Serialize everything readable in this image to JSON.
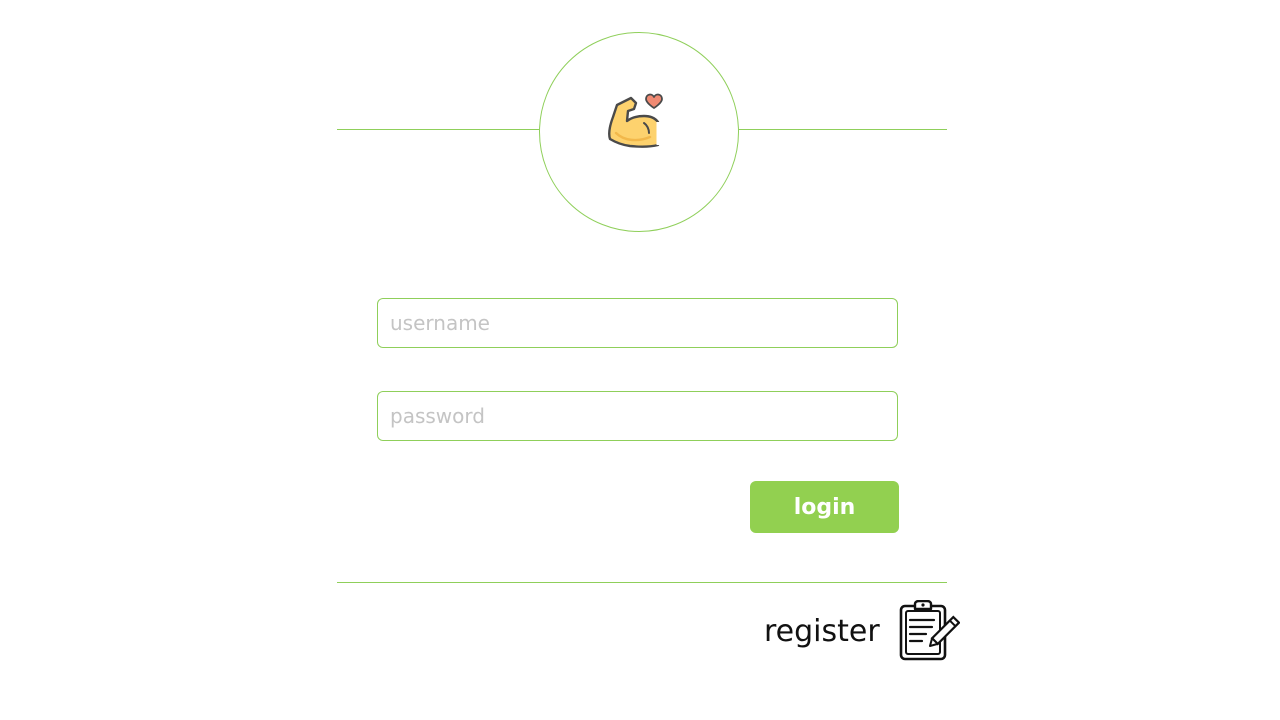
{
  "logo": {
    "icon": "flexed-bicep-heart-icon"
  },
  "form": {
    "username_placeholder": "username",
    "password_placeholder": "password",
    "login_label": "login"
  },
  "footer": {
    "register_label": "register",
    "register_icon": "clipboard-edit-icon"
  },
  "colors": {
    "accent": "#92d050",
    "line": "#8fcf5a",
    "placeholder": "#c4c4c4",
    "text": "#111111"
  }
}
